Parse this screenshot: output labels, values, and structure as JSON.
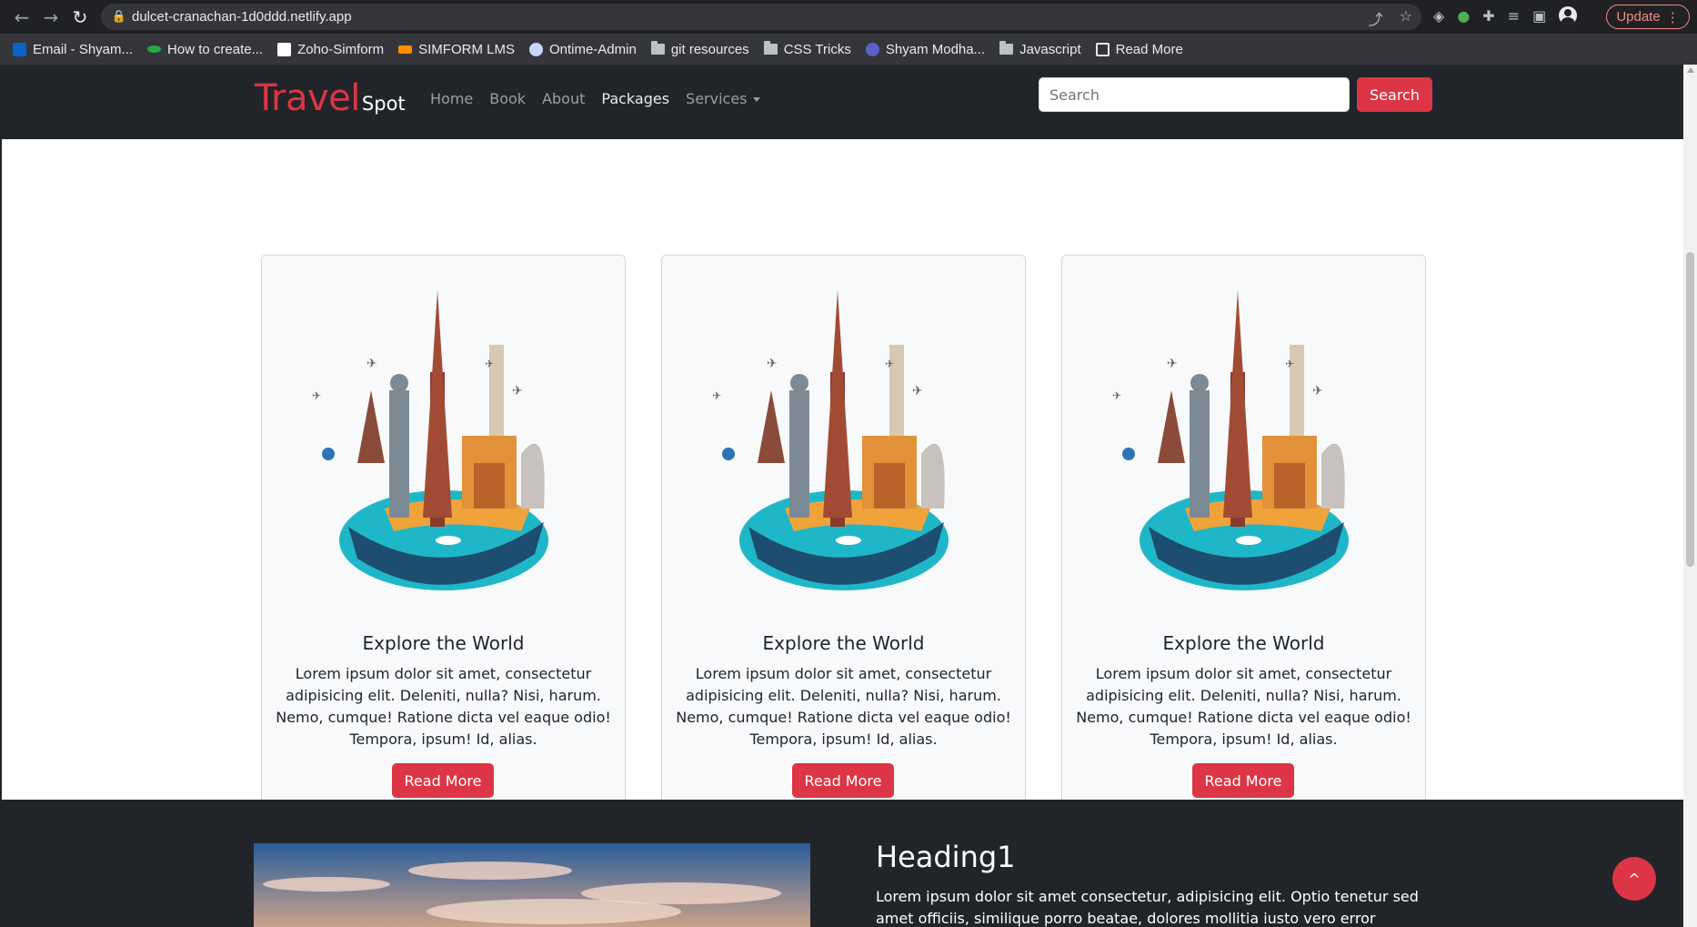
{
  "browser": {
    "url": "dulcet-cranachan-1d0ddd.netlify.app",
    "update_label": "Update",
    "bookmarks": [
      {
        "label": "Email - Shyam...",
        "color": "#0a64c8"
      },
      {
        "label": "How to create...",
        "color": "#27a845"
      },
      {
        "label": "Zoho-Simform",
        "color": "#ffffff"
      },
      {
        "label": "SIMFORM LMS",
        "color": "#ff8c00"
      },
      {
        "label": "Ontime-Admin",
        "color": "#c6d7ff"
      },
      {
        "label": "git resources",
        "color": "folder"
      },
      {
        "label": "CSS Tricks",
        "color": "folder"
      },
      {
        "label": "Shyam Modha...",
        "color": "#5b5fc7"
      },
      {
        "label": "Javascript",
        "color": "folder"
      },
      {
        "label": "Read More",
        "color": "#e8eaed"
      }
    ]
  },
  "navbar": {
    "brand_main": "Travel",
    "brand_sub": "Spot",
    "links": [
      "Home",
      "Book",
      "About",
      "Packages",
      "Services"
    ],
    "search_placeholder": "Search",
    "search_button": "Search"
  },
  "cards": [
    {
      "title": "Explore the World",
      "text": "Lorem ipsum dolor sit amet, consectetur adipisicing elit. Deleniti, nulla? Nisi, harum. Nemo, cumque! Ratione dicta vel eaque odio! Tempora, ipsum! Id, alias.",
      "button": "Read More"
    },
    {
      "title": "Explore the World",
      "text": "Lorem ipsum dolor sit amet, consectetur adipisicing elit. Deleniti, nulla? Nisi, harum. Nemo, cumque! Ratione dicta vel eaque odio! Tempora, ipsum! Id, alias.",
      "button": "Read More"
    },
    {
      "title": "Explore the World",
      "text": "Lorem ipsum dolor sit amet, consectetur adipisicing elit. Deleniti, nulla? Nisi, harum. Nemo, cumque! Ratione dicta vel eaque odio! Tempora, ipsum! Id, alias.",
      "button": "Read More"
    }
  ],
  "section2": {
    "heading": "Heading1",
    "text": "Lorem ipsum dolor sit amet consectetur, adipisicing elit. Optio tenetur sed amet officiis, similique porro beatae, dolores mollitia iusto vero error"
  },
  "scroll_top_label": "^",
  "colors": {
    "accent": "#dc3545",
    "dark": "#212529",
    "card_bg": "#f8f9fa"
  }
}
